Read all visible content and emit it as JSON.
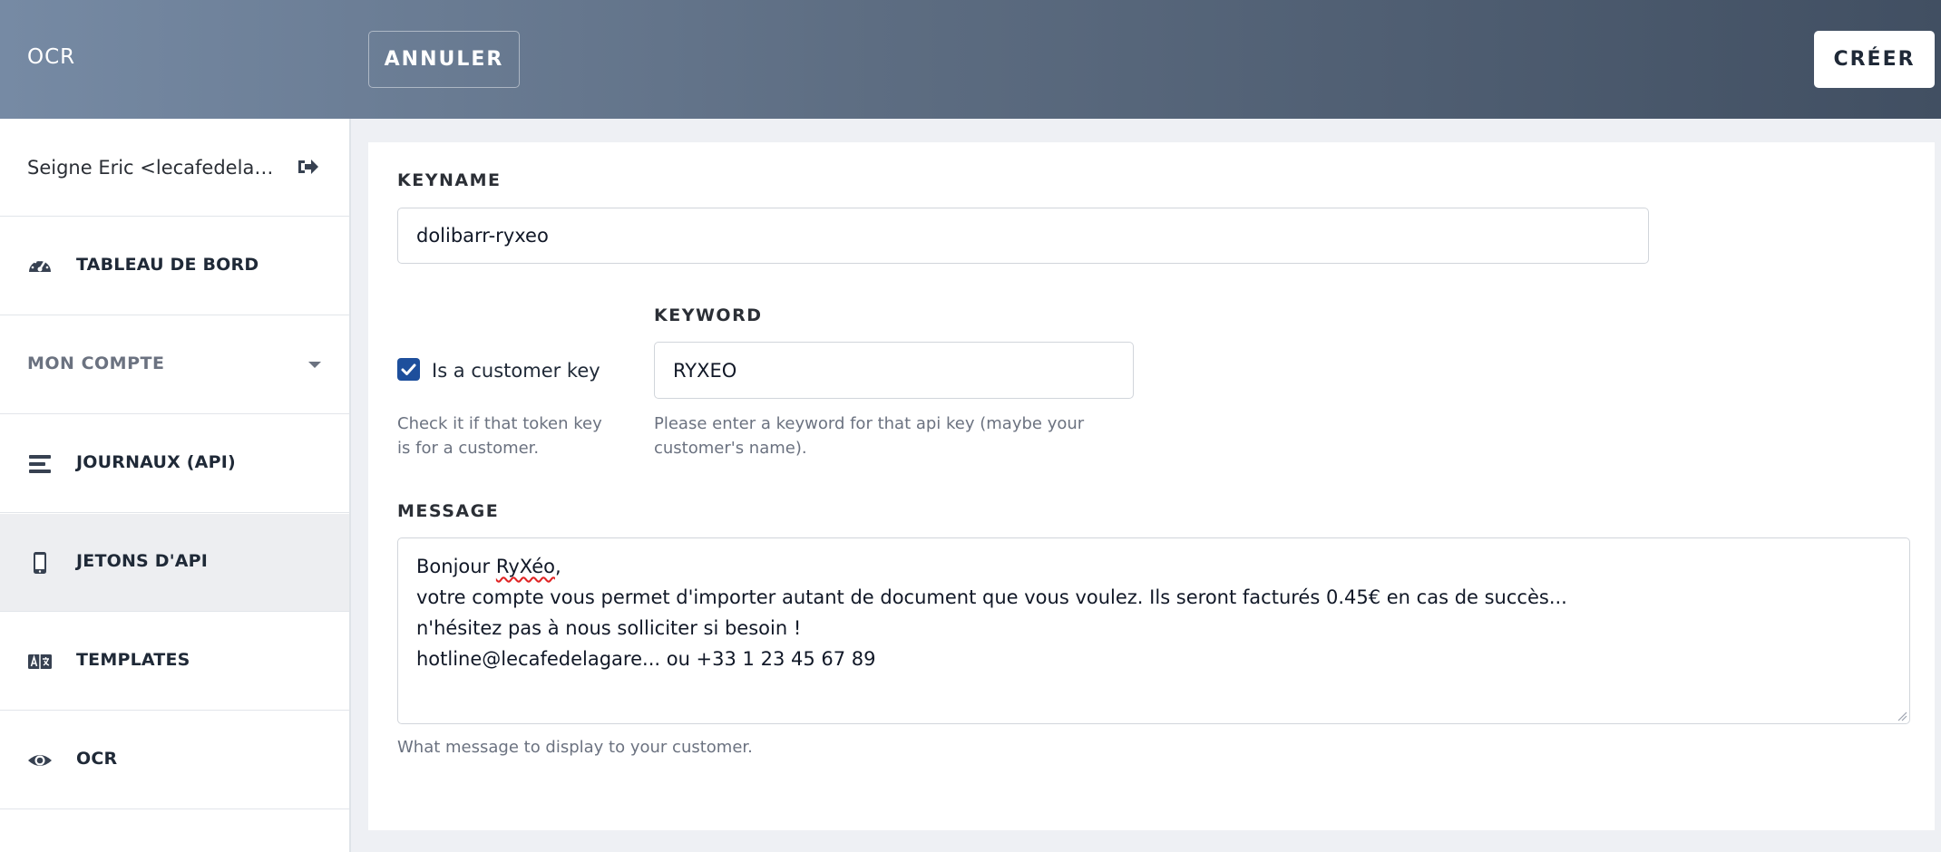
{
  "header": {
    "app_title": "OCR",
    "cancel_label": "ANNULER",
    "create_label": "CRÉER"
  },
  "sidebar": {
    "user": "Seigne Eric <lecafedelagare...",
    "items": [
      {
        "label": "TABLEAU DE BORD",
        "icon": "dashboard-icon"
      },
      {
        "label": "MON COMPTE",
        "icon": "chevron-down-icon"
      },
      {
        "label": "JOURNAUX (API)",
        "icon": "list-icon"
      },
      {
        "label": "JETONS D'API",
        "icon": "mobile-icon",
        "active": true
      },
      {
        "label": "TEMPLATES",
        "icon": "language-icon"
      },
      {
        "label": "OCR",
        "icon": "eye-icon"
      }
    ]
  },
  "form": {
    "keyname_label": "KEYNAME",
    "keyname_value": "dolibarr-ryxeo",
    "customer_checkbox_label": "Is a customer key",
    "customer_checkbox_checked": true,
    "customer_help": "Check it if that token key is for a customer.",
    "keyword_label": "KEYWORD",
    "keyword_value": "RYXEO",
    "keyword_help": "Please enter a keyword for that api key (maybe your customer's name).",
    "message_label": "MESSAGE",
    "message_line1_prefix": "Bonjour ",
    "message_line1_word": "RyXéo",
    "message_line1_suffix": ",",
    "message_line2": "votre compte vous permet d'importer autant de document que vous voulez. Ils seront facturés 0.45€ en cas de succès...",
    "message_line3": "n'hésitez pas à nous solliciter si besoin !",
    "message_line4": "hotline@lecafedelagare... ou +33 1 23 45 67 89",
    "message_help": "What message to display to your customer."
  },
  "colors": {
    "accent": "#1e4f9c",
    "header_gradient_start": "#768aa4",
    "header_gradient_end": "#414f62"
  }
}
